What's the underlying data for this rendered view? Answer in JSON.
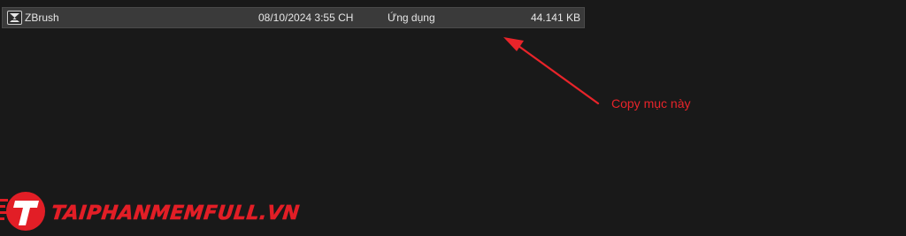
{
  "file_list": {
    "rows": [
      {
        "icon": "zbrush-app-icon",
        "name": "ZBrush",
        "date_modified": "08/10/2024 3:55 CH",
        "type": "Ứng dụng",
        "size": "44.141 KB"
      }
    ]
  },
  "annotation": {
    "text": "Copy mục này",
    "color": "#e8242a"
  },
  "watermark": {
    "text": "TAIPHANMEMFULL.VN",
    "color": "#e21e26"
  },
  "colors": {
    "background": "#191919",
    "row_selected": "#3a3a3a",
    "row_text": "#e6e6e6"
  }
}
